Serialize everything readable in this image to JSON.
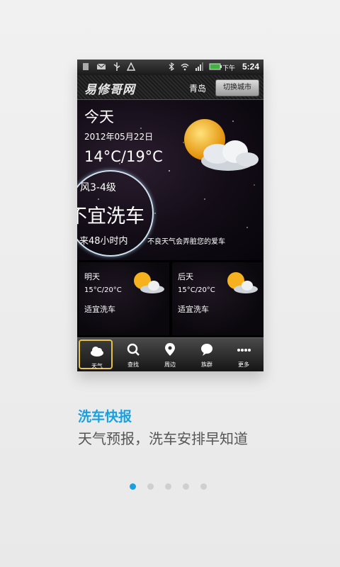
{
  "status_bar": {
    "ampm": "下午",
    "time": "5:24"
  },
  "header": {
    "logo": "易修哥网",
    "city": "青岛",
    "switch_city": "切换城市"
  },
  "today": {
    "label": "今天",
    "date": "2012年05月22日",
    "temp": "14°C/19°C",
    "wind": "风3-4级",
    "wash": "不宜洗车",
    "within": "来48小时内",
    "tip": "不良天气会弄脏您的爱车"
  },
  "forecast": [
    {
      "title": "明天",
      "temp": "15°C/20°C",
      "wash": "适宜洗车"
    },
    {
      "title": "后天",
      "temp": "15°C/20°C",
      "wash": "适宜洗车"
    }
  ],
  "tabs": [
    {
      "label": "天气",
      "icon": "cloud-icon"
    },
    {
      "label": "查找",
      "icon": "search-icon"
    },
    {
      "label": "周边",
      "icon": "location-pin-icon"
    },
    {
      "label": "族群",
      "icon": "chat-bubble-icon"
    },
    {
      "label": "更多",
      "icon": "more-dots-icon"
    }
  ],
  "promo": {
    "headline": "洗车快报",
    "subline": "天气预报，洗车安排早知道"
  },
  "pager": {
    "total": 5,
    "active": 0
  },
  "colors": {
    "accent": "#1aa0e0",
    "tab_highlight": "#e6c14a",
    "sun": "#f5b21e"
  }
}
